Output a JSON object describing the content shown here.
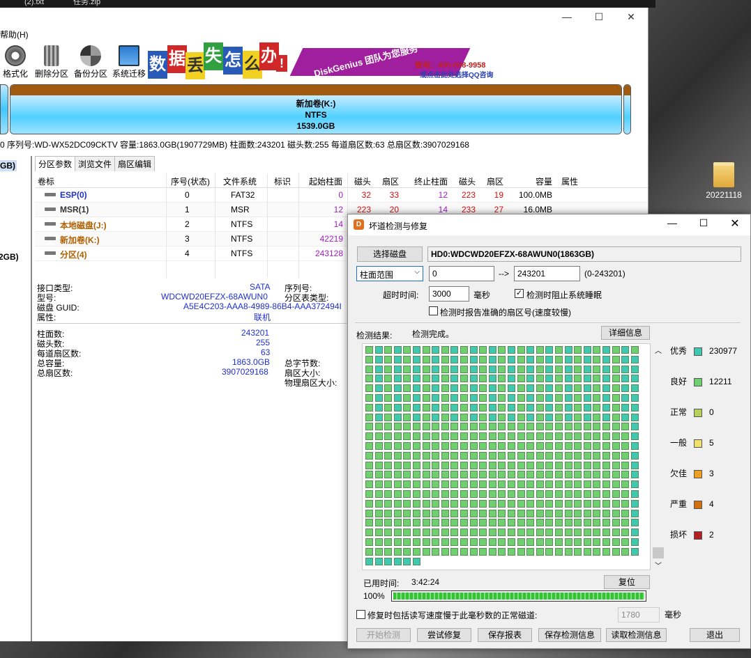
{
  "taskbar": {
    "item1": "(2).txt",
    "item2": "任务.zip"
  },
  "main": {
    "menu_help": "帮助(H)",
    "toolbar": [
      {
        "label": "格式化",
        "icon": "format-icon"
      },
      {
        "label": "删除分区",
        "icon": "trash-icon"
      },
      {
        "label": "备份分区",
        "icon": "backup-icon"
      },
      {
        "label": "系统迁移",
        "icon": "migrate-icon"
      }
    ],
    "banner": {
      "chars": [
        "数",
        "据",
        "丢",
        "失",
        "怎",
        "么",
        "办",
        "!"
      ],
      "slogan": "DiskGenius 团队为您服务",
      "phone": "致电：400-008-9958",
      "qq": "或点击此处选择QQ咨询"
    },
    "partition_bar": {
      "name": "新加卷(K:)",
      "fs": "NTFS",
      "size": "1539.0GB"
    },
    "disk_info": "0  序列号:WD-WX52DC09CKTV  容量:1863.0GB(1907729MB)  柱面数:243201  磁头数:255  每道扇区数:63  总扇区数:3907029168",
    "left_panel": {
      "item1": "GB)",
      "item2": "2GB)"
    },
    "tabs": [
      "分区参数",
      "浏览文件",
      "扇区编辑"
    ],
    "table": {
      "headers": [
        "卷标",
        "序号(状态)",
        "文件系统",
        "标识",
        "起始柱面",
        "磁头",
        "扇区",
        "终止柱面",
        "磁头",
        "扇区",
        "容量",
        "属性"
      ],
      "rows": [
        {
          "label": "ESP(0)",
          "idx": "0",
          "fs": "FAT32",
          "sc": "0",
          "sh": "32",
          "ss": "33",
          "ec": "12",
          "eh": "223",
          "es": "19",
          "cap": "100.0MB",
          "color": "#2030d0"
        },
        {
          "label": "MSR(1)",
          "idx": "1",
          "fs": "MSR",
          "sc": "12",
          "sh": "223",
          "ss": "20",
          "ec": "14",
          "eh": "233",
          "es": "27",
          "cap": "16.0MB",
          "color": "#333333"
        },
        {
          "label": "本地磁盘(J:)",
          "idx": "2",
          "fs": "NTFS",
          "sc": "14",
          "sh": "",
          "ss": "",
          "ec": "",
          "eh": "",
          "es": "",
          "cap": "",
          "color": "#b06000"
        },
        {
          "label": "新加卷(K:)",
          "idx": "3",
          "fs": "NTFS",
          "sc": "42219",
          "sh": "",
          "ss": "",
          "ec": "",
          "eh": "",
          "es": "",
          "cap": "",
          "color": "#b06000"
        },
        {
          "label": "分区(4)",
          "idx": "4",
          "fs": "NTFS",
          "sc": "243128",
          "sh": "",
          "ss": "",
          "ec": "",
          "eh": "",
          "es": "",
          "cap": "",
          "color": "#b06000"
        }
      ]
    },
    "props1": {
      "iface_k": "接口类型:",
      "iface_v": "SATA",
      "model_k": "型号:",
      "model_v": "WDCWD20EFZX-68AWUN0",
      "guid_k": "磁盘 GUID:",
      "guid_v": "A5E4C203-AAA8-4989-86B4-AAA372494I",
      "attr_k": "属性:",
      "attr_v": "联机",
      "serial_k": "序列号:",
      "ptype_k": "分区表类型:"
    },
    "props2": {
      "cyl_k": "柱面数:",
      "cyl_v": "243201",
      "heads_k": "磁头数:",
      "heads_v": "255",
      "spt_k": "每道扇区数:",
      "spt_v": "63",
      "cap_k": "总容量:",
      "cap_v": "1863.0GB",
      "sec_k": "总扇区数:",
      "sec_v": "3907029168",
      "bytes_k": "总字节数:",
      "secsize_k": "扇区大小:",
      "phys_k": "物理扇区大小:"
    }
  },
  "dialog": {
    "title": "坏道检测与修复",
    "select_disk": "选择磁盘",
    "disk_name": "HD0:WDCWD20EFZX-68AWUN0(1863GB)",
    "range_mode": "柱面范围",
    "range_from": "0",
    "arrow": "-->",
    "range_to": "243201",
    "range_hint": "(0-243201)",
    "timeout_label": "超时时间:",
    "timeout_value": "3000",
    "timeout_unit": "毫秒",
    "prevent_sleep": "检测时阻止系统睡眠",
    "report_sector": "检测时报告准确的扇区号(速度较慢)",
    "result_label": "检测结果:",
    "result_status": "检测完成。",
    "details_btn": "详细信息",
    "legend": [
      {
        "name": "优秀",
        "count": "230977",
        "color": "#40c8b0"
      },
      {
        "name": "良好",
        "count": "12211",
        "color": "#70d070"
      },
      {
        "name": "正常",
        "count": "0",
        "color": "#b8d060"
      },
      {
        "name": "一般",
        "count": "5",
        "color": "#f0e070"
      },
      {
        "name": "欠佳",
        "count": "3",
        "color": "#f0a020"
      },
      {
        "name": "严重",
        "count": "4",
        "color": "#d07010"
      },
      {
        "name": "损坏",
        "count": "2",
        "color": "#b02020"
      }
    ],
    "elapsed_label": "已用时间:",
    "elapsed_value": "3:42:24",
    "reset_btn": "复位",
    "progress_text": "100%",
    "progress": 1.0,
    "repair_option": "修复时包括读写速度慢于此毫秒数的正常磁道:",
    "repair_ms": "1780",
    "repair_unit": "毫秒",
    "buttons": [
      "开始检测",
      "尝试修复",
      "保存报表",
      "保存检测信息",
      "读取检测信息",
      "退出"
    ]
  },
  "desktop": {
    "folder_label": "20221118"
  }
}
